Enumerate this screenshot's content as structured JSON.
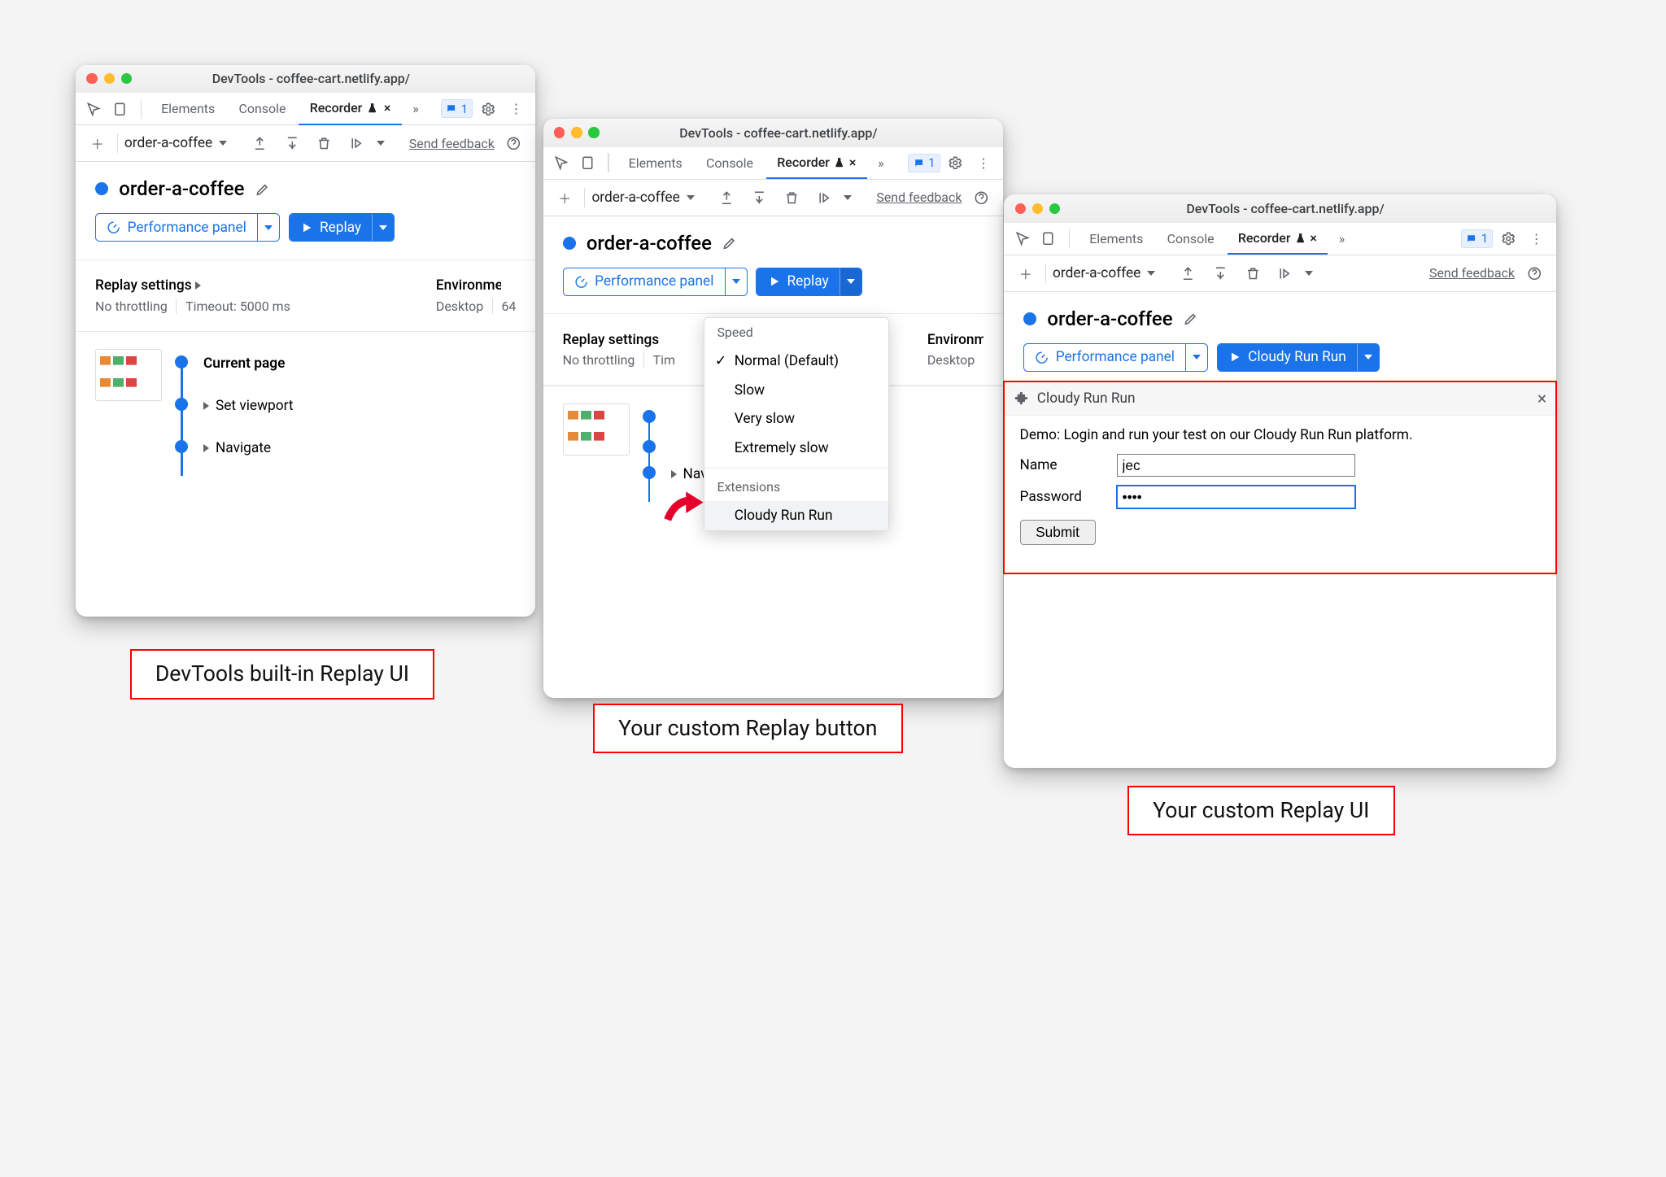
{
  "title": "DevTools - coffee-cart.netlify.app/",
  "tabs": {
    "elements": "Elements",
    "console": "Console",
    "recorder": "Recorder",
    "issues_count": "1"
  },
  "toolbar": {
    "recording_name": "order-a-coffee",
    "feedback": "Send feedback"
  },
  "recorder": {
    "title": "order-a-coffee",
    "perf_panel": "Performance panel",
    "replay": "Replay",
    "replay_custom": "Cloudy Run Run",
    "settings_heading": "Replay settings",
    "no_throttling": "No throttling",
    "timeout": "Timeout: 5000 ms",
    "env_heading": "Environment",
    "env_desktop": "Desktop",
    "env_value": "64",
    "steps": [
      "Current page",
      "Set viewport",
      "Navigate"
    ]
  },
  "replay_menu": {
    "speed_heading": "Speed",
    "items": [
      "Normal (Default)",
      "Slow",
      "Very slow",
      "Extremely slow"
    ],
    "ext_heading": "Extensions",
    "ext_item": "Cloudy Run Run"
  },
  "extension": {
    "name": "Cloudy Run Run",
    "desc": "Demo: Login and run your test on our Cloudy Run Run platform.",
    "name_label": "Name",
    "name_value": "jec",
    "password_label": "Password",
    "password_value": "••••",
    "submit": "Submit"
  },
  "captions": {
    "c1": "DevTools built-in Replay UI",
    "c2": "Your custom Replay button",
    "c3": "Your custom Replay UI"
  }
}
